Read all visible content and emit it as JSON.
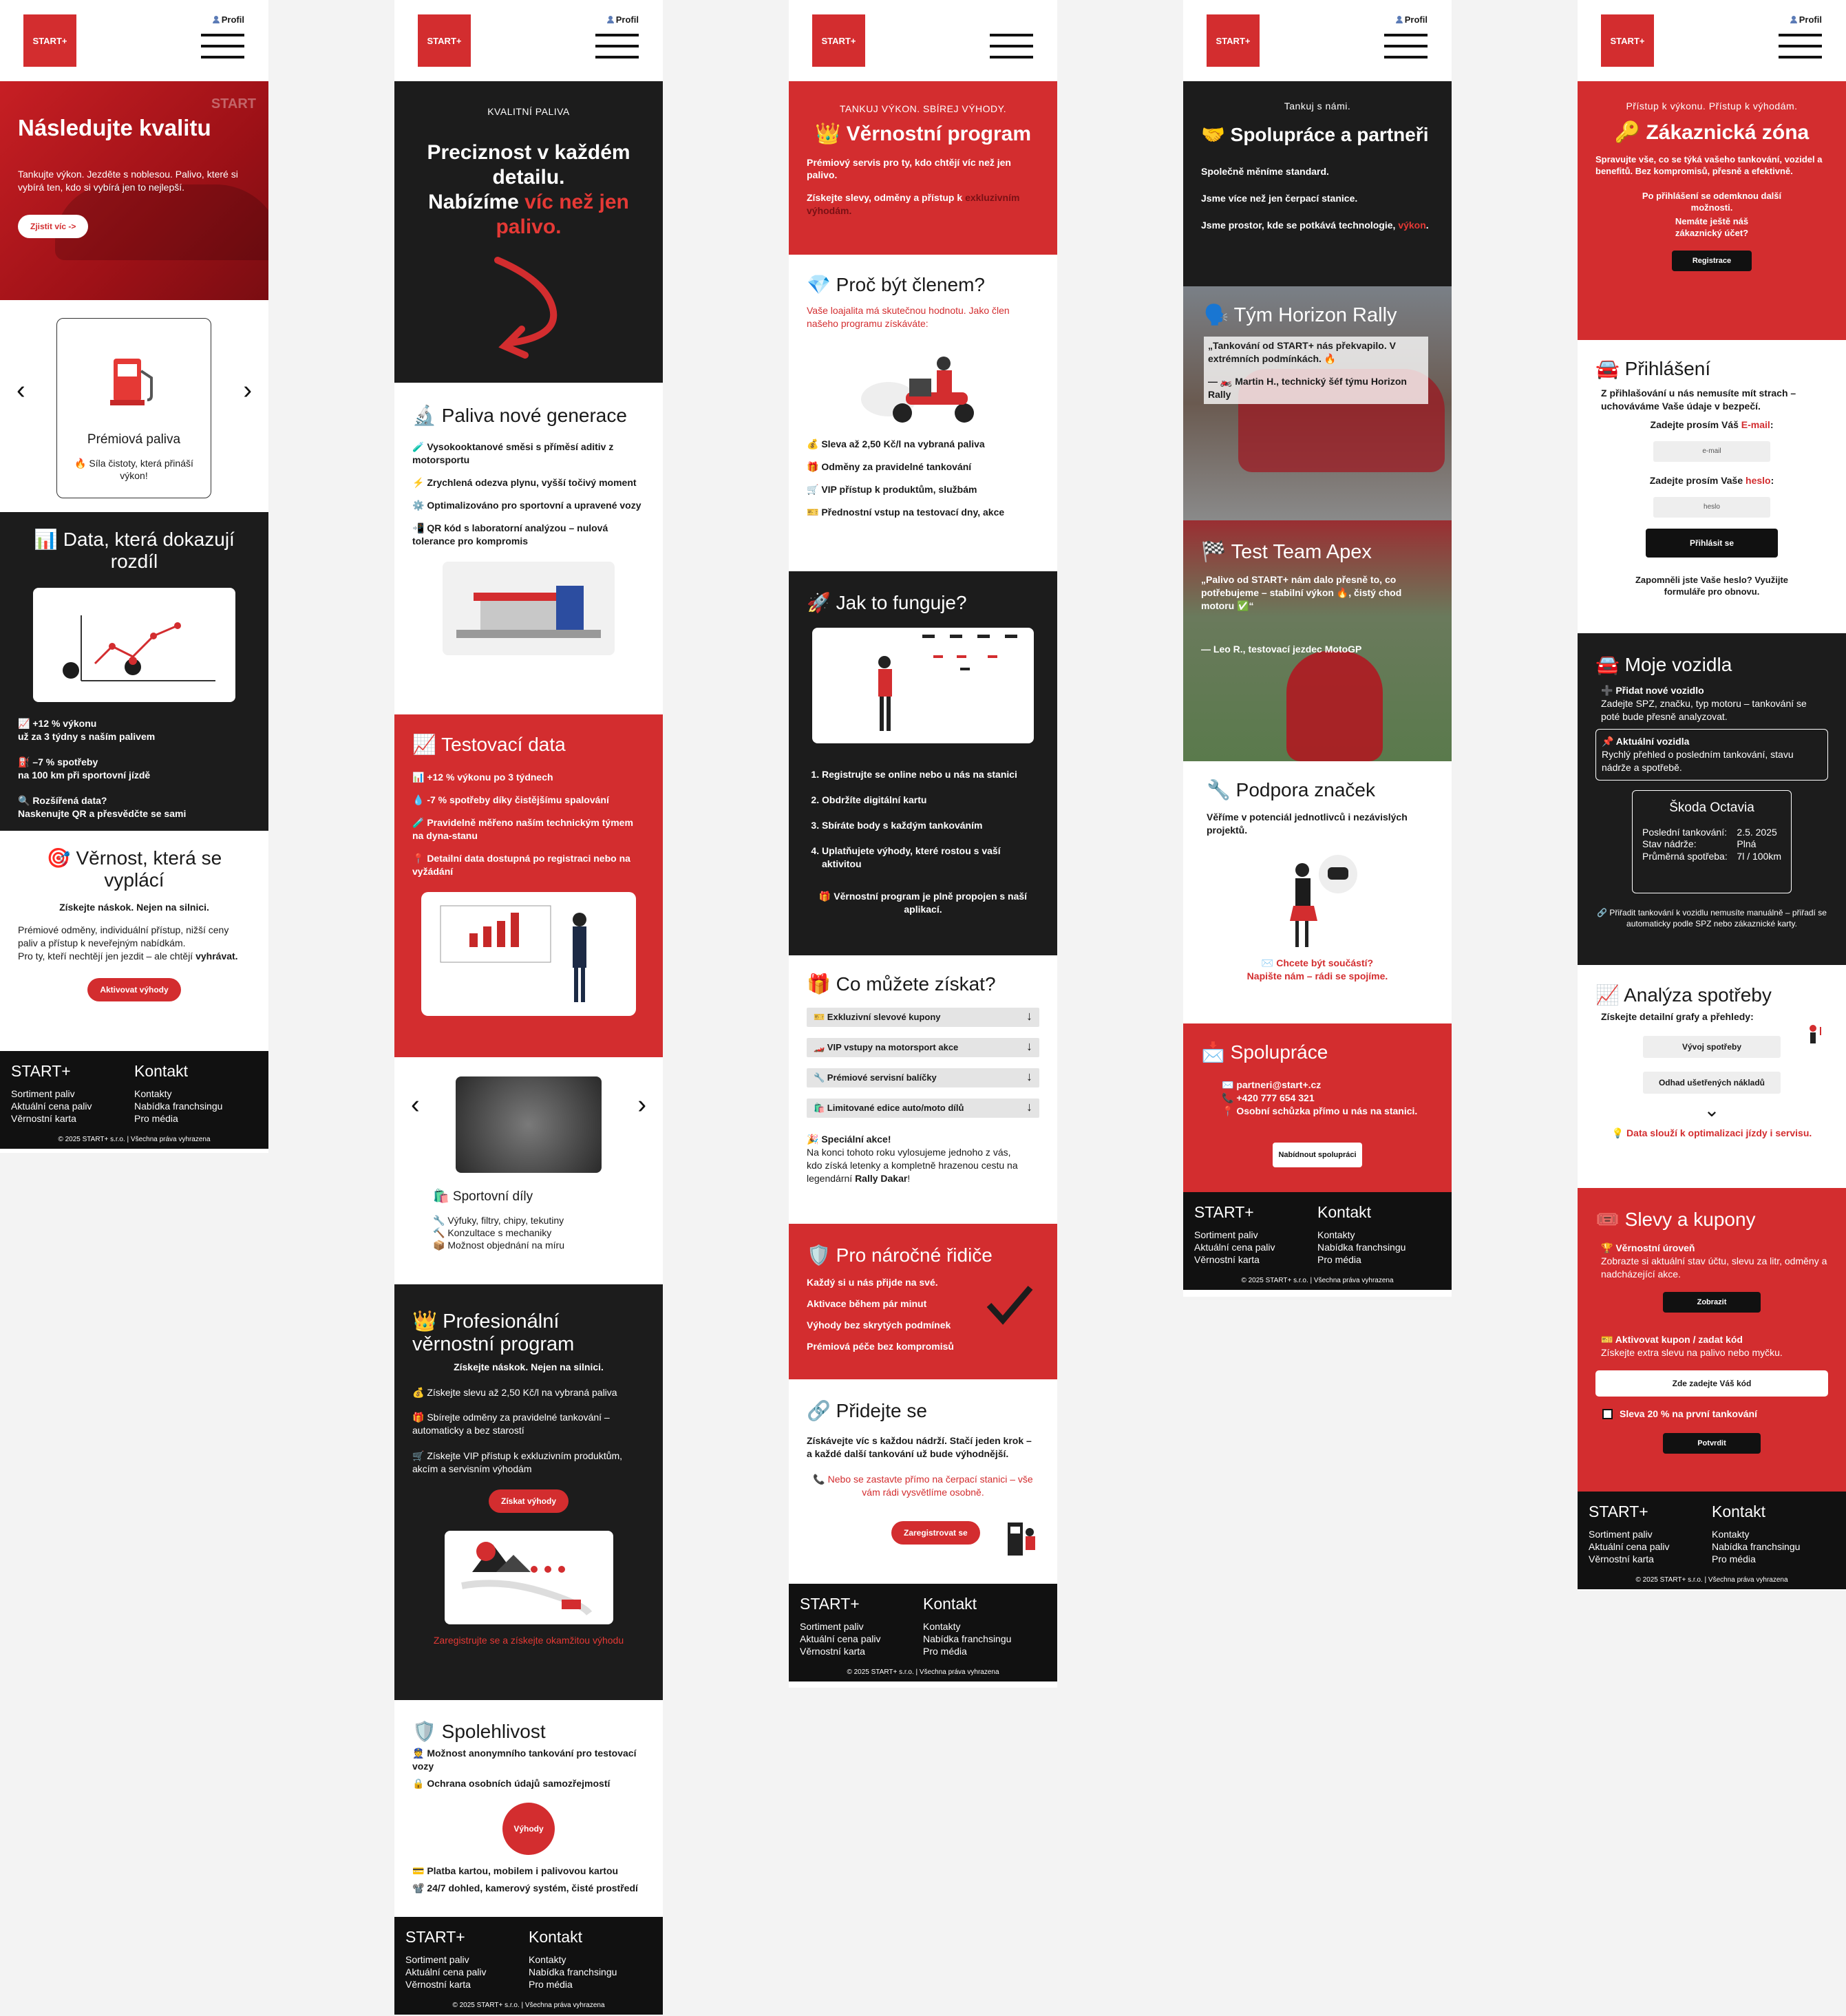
{
  "brand": {
    "logo": "START+",
    "profile": "Profil",
    "accent": "#d32d2f",
    "dark": "#1c1c1c"
  },
  "footer": {
    "col1_title": "START+",
    "col1_links": [
      "Sortiment paliv",
      "Aktuální cena paliv",
      "Věrnostní karta"
    ],
    "col2_title": "Kontakt",
    "col2_links": [
      "Kontakty",
      "Nabídka franchsingu",
      "Pro média"
    ],
    "copyright": "© 2025 START+ s.r.o. | Všechna práva vyhrazena"
  },
  "s1": {
    "hero": {
      "title": "Následujte kvalitu",
      "text": "Tankujte výkon. Jezděte s noblesou. Palivo, které si vybírá ten, kdo si vybírá jen to nejlepší.",
      "cta": "Zjistit víc ->",
      "sign": "START"
    },
    "carousel": {
      "title": "Prémiová paliva",
      "text": "🔥 Síla čistoty, která přináší výkon!"
    },
    "data": {
      "title": "📊 Data, která dokazují rozdíl",
      "i1a": "📈 +12 % výkonu",
      "i1b": "už za 3 týdny s naším palivem",
      "i2a": "⛽ –7 % spotřeby",
      "i2b": "na 100 km při sportovní jízdě",
      "i3a": "🔍 Rozšířená data?",
      "i3b": "Naskenujte QR a přesvědčte se sami"
    },
    "loyal": {
      "title": "🎯 Věrnost, která se vyplácí",
      "sub": "Získejte náskok. Nejen na silnici.",
      "text": "Prémiové odměny, individuální přístup, nižší ceny paliv a přístup k neveřejným nabídkám.",
      "text2": "Pro ty, kteří nechtějí jen jezdit – ale chtějí",
      "text2b": "vyhrávat.",
      "cta": "Aktivovat výhody"
    }
  },
  "s2": {
    "hero": {
      "kicker": "KVALITNÍ PALIVA",
      "t1": "Preciznost v každém detailu.",
      "t2": "Nabízíme ",
      "t3": "víc než jen palivo."
    },
    "gen": {
      "title": "🔬 Paliva nové generace",
      "items": [
        "🧪 Vysokooktanové směsi s příměsí aditiv z motorsportu",
        "⚡ Zrychlená odezva plynu, vyšší točivý moment",
        "⚙️ Optimalizováno pro sportovní a upravené vozy",
        "📲 QR kód s laboratorní analýzou – nulová tolerance pro kompromis"
      ]
    },
    "test": {
      "title": "📈 Testovací data",
      "items": [
        "📊 +12 % výkonu po 3 týdnech",
        "💧 -7 % spotřeby díky čistějšímu spalování",
        "🧪 Pravidelně měřeno naším technickým týmem na dyna-stanu",
        "📍 Detailní data dostupná po registraci nebo na vyžádání"
      ]
    },
    "parts": {
      "title": "🛍️ Sportovní díly",
      "items": [
        "🔧 Výfuky, filtry, chipy, tekutiny",
        "🔨 Konzultace s mechaniky",
        "📦 Možnost objednání na míru"
      ]
    },
    "pro": {
      "title": "👑 Profesionální věrnostní program",
      "sub": "Získejte náskok. Nejen na silnici.",
      "items": [
        "💰 Získejte slevu až 2,50 Kč/l na vybraná paliva",
        "🎁 Sbírejte odměny za pravidelné tankování – automaticky a bez starostí",
        "🛒 Získejte VIP přístup k exkluzivním produktům, akcím a servisním výhodám"
      ],
      "cta": "Získat výhody",
      "link": "Zaregistrujte se a získejte okamžitou výhodu"
    },
    "rel": {
      "title": "🛡️ Spolehlivost",
      "items": [
        "👮 Možnost anonymního tankování pro testovací vozy",
        "🔒 Ochrana osobních údajů samozřejmostí"
      ],
      "cta": "Výhody",
      "items2": [
        "💳 Platba kartou, mobilem i palivovou kartou",
        "📽️ 24/7 dohled, kamerový systém, čisté prostředí"
      ]
    }
  },
  "s3": {
    "hero": {
      "kicker": "TANKUJ VÝKON. SBÍREJ VÝHODY.",
      "title": "👑 Věrnostní program",
      "t1": "Prémiový servis pro ty, kdo chtějí víc než jen palivo.",
      "t2": "Získejte slevy, odměny a přístup k ",
      "t2b": "exkluzivním výhodám."
    },
    "why": {
      "title": "💎 Proč být členem?",
      "text": "Vaše loajalita má skutečnou hodnotu. Jako člen našeho programu získáváte:",
      "items": [
        "💰 Sleva až 2,50 Kč/l na vybraná paliva",
        "🎁 Odměny za pravidelné tankování",
        "🛒 VIP přístup k produktům, službám",
        "🎫 Přednostní vstup na testovací dny, akce"
      ]
    },
    "how": {
      "title": "🚀 Jak to funguje?",
      "steps": [
        "Registrujte se online nebo u nás na stanici",
        "Obdržíte digitální kartu",
        "Sbíráte body s každým tankováním",
        "Uplatňujete výhody, které rostou s vaší aktivitou"
      ],
      "note": "🎁 Věrnostní program je plně propojen s naší aplikací."
    },
    "gain": {
      "title": "🎁 Co můžete získat?",
      "acc": [
        "🎫 Exkluzivní slevové kupony",
        "🏎️ VIP vstupy na motorsport akce",
        "🔧 Prémiové servisní balíčky",
        "🛍️ Limitované edice auto/moto dílů"
      ],
      "sp1": "🎉 Speciální akce!",
      "sp2": "Na konci tohoto roku vylosujeme jednoho z vás,",
      "sp3": "kdo získá letenky a kompletně hrazenou cestu na legendární ",
      "sp4": "Rally Dakar",
      "sp5": "!"
    },
    "drivers": {
      "title": "🛡️ Pro náročné řidiče",
      "items": [
        "Každý si u nás přijde na své.",
        "Aktivace během pár minut",
        "Výhody bez skrytých podmínek",
        "Prémiová péče bez kompromisů"
      ]
    },
    "join": {
      "title": "🔗 Přidejte se",
      "t1": "Získávejte víc s každou nádrží. Stačí jeden krok – a každé další tankování už bude výhodnější.",
      "t2": "📞 Nebo se zastavte přímo na čerpací stanici – vše vám rádi vysvětlíme osobně.",
      "cta": "Zaregistrovat se"
    }
  },
  "s4": {
    "hero": {
      "kicker": "Tankuj s námi.",
      "title": "🤝 Spolupráce a partneři",
      "l1": "Společně měníme standard.",
      "l2": "Jsme více než jen čerpací stanice.",
      "l3": "Jsme prostor, kde se potkává technologie, ",
      "l3b": "výkon",
      "l3c": "."
    },
    "team1": {
      "title": "🗣️ Tým Horizon Rally",
      "quote": "„Tankování od START+ nás překvapilo. V extrémních podmínkách. 🔥",
      "author": "— 🏍️ Martin H., technický šéf týmu Horizon Rally"
    },
    "team2": {
      "title": "🏁 Test Team Apex",
      "quote": "„Palivo od START+ nám dalo přesně to, co potřebujeme – stabilní výkon 🔥, čistý chod motoru ✅“",
      "author": "— Leo R., testovací jezdec MotoGP"
    },
    "support": {
      "title": "🔧 Podpora značek",
      "text": "Věříme v potenciál jednotlivců i nezávislých projektů.",
      "q1": "✉️ Chcete být součástí?",
      "q2": "Napište nám – rádi se spojíme."
    },
    "coop": {
      "title": "📩 Spolupráce",
      "l1": "✉️ partneri@start+.cz",
      "l2": "📞 +420 777 654 321",
      "l3": "📍 Osobní schůzka přímo u nás na stanici.",
      "cta": "Nabídnout spolupráci"
    }
  },
  "s5": {
    "hero": {
      "kicker": "Přístup k výkonu. Přístup k výhodám.",
      "title": "🔑 Zákaznická zóna",
      "t1": "Spravujte vše, co se týká vašeho tankování, vozidel a benefitů. Bez kompromisů, přesně a efektivně.",
      "t2": "Po přihlášení se odemknou další možnosti.",
      "t3": "Nemáte ještě náš zákaznický účet?",
      "cta": "Registrace"
    },
    "login": {
      "title": "🚘 Přihlášení",
      "text": "Z přihlašování u nás nemusíte mít strach – uchováváme Vaše údaje v bezpečí.",
      "l_email": "Zadejte prosím Váš ",
      "l_email_b": "E-mail",
      "l_pass": "Zadejte prosím Vaše ",
      "l_pass_b": "heslo",
      "ph_email": "e-mail",
      "ph_pass": "heslo",
      "cta": "Přihlásit se",
      "forgot": "Zapomněli jste Vaše heslo? Využijte formuláře pro obnovu."
    },
    "veh": {
      "title": "🚘 Moje vozidla",
      "add_t": "➕ Přidat nové vozidlo",
      "add_d": "Zadejte SPZ, značku, typ motoru – tankování se poté bude přesně analyzovat.",
      "cur_t": "📌 Aktuální vozidla",
      "cur_d": "Rychlý přehled o posledním tankování, stavu nádrže a spotřebě.",
      "car": "Škoda Octavia",
      "k1": "Poslední tankování:",
      "v1": "2.5. 2025",
      "k2": "Stav nádrže:",
      "v2": "Plná",
      "k3": "Průměrná spotřeba:",
      "v3": "7l / 100km",
      "note": "🔗 Přiřadit tankování k vozidlu nemusíte manuálně – přiřadí se automaticky podle SPZ nebo zákaznické karty."
    },
    "ana": {
      "title": "📈 Analýza spotřeby",
      "sub": "Získejte detailní grafy a přehledy:",
      "b1": "Vývoj spotřeby",
      "b2": "Odhad ušetřených nákladů",
      "note": "💡 Data slouží k optimalizaci jízdy i servisu."
    },
    "coupons": {
      "title": "🎟️ Slevy a kupony",
      "l1": "🏆 Věrnostní úroveň",
      "d1": "Zobrazte si aktuální stav účtu, slevu za litr, odměny a nadcházející akce.",
      "b1": "Zobrazit",
      "l2": "🎫 Aktivovat kupon / zadat kód",
      "d2": "Získejte extra slevu na palivo nebo myčku.",
      "ph": "Zde zadejte Váš kód",
      "chk": "Sleva 20 % na první tankování",
      "b2": "Potvrdit"
    }
  }
}
